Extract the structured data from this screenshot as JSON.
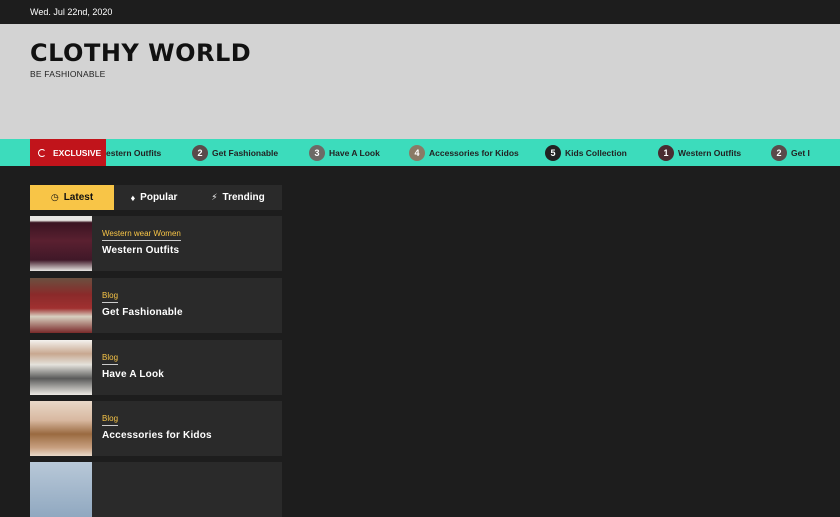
{
  "topbar": {
    "date": "Wed. Jul 22nd, 2020"
  },
  "site": {
    "title": "CLOTHY WORLD",
    "tagline": "BE FASHIONABLE"
  },
  "ticker": {
    "label": "EXCLUSIVE",
    "items": [
      {
        "num": "",
        "label": "estern Outfits"
      },
      {
        "num": "2",
        "label": "Get Fashionable"
      },
      {
        "num": "3",
        "label": "Have A Look"
      },
      {
        "num": "4",
        "label": "Accessories for Kidos"
      },
      {
        "num": "5",
        "label": "Kids Collection"
      },
      {
        "num": "1",
        "label": "Western Outfits"
      },
      {
        "num": "2",
        "label": "Get I"
      }
    ]
  },
  "tabs": [
    {
      "label": "Latest",
      "icon": "clock-icon"
    },
    {
      "label": "Popular",
      "icon": "fire-icon"
    },
    {
      "label": "Trending",
      "icon": "bolt-icon"
    }
  ],
  "posts": [
    {
      "category": "Western wear Women",
      "title": "Western Outfits"
    },
    {
      "category": "Blog",
      "title": "Get Fashionable"
    },
    {
      "category": "Blog",
      "title": "Have A Look"
    },
    {
      "category": "Blog",
      "title": "Accessories for Kidos"
    }
  ],
  "colors": {
    "accent_teal": "#3cdcbc",
    "exclusive_red": "#c1141b",
    "tab_yellow": "#f8c547",
    "header_grey": "#d3d3d3",
    "dark_bg": "#1d1d1d"
  }
}
